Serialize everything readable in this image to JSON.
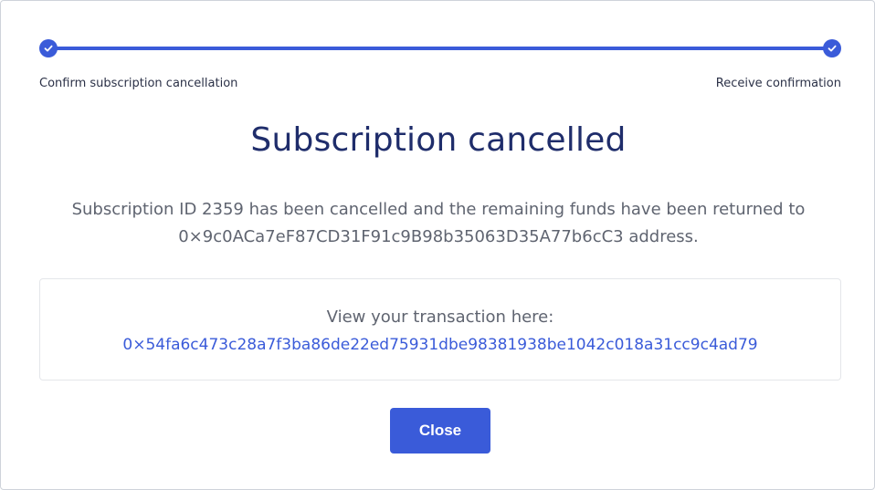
{
  "stepper": {
    "steps": [
      {
        "label": "Confirm subscription cancellation",
        "state": "complete"
      },
      {
        "label": "Receive confirmation",
        "state": "complete"
      }
    ],
    "accent_color": "#3a5bd9"
  },
  "title": "Subscription cancelled",
  "message": {
    "line1": "Subscription ID 2359 has been cancelled and the remaining funds have been returned to",
    "line2": "0×9c0ACa7eF87CD31F91c9B98b35063D35A77b6cC3 address."
  },
  "transaction": {
    "label": "View your transaction here:",
    "hash": "0×54fa6c473c28a7f3ba86de22ed75931dbe98381938be1042c018a31cc9c4ad79"
  },
  "actions": {
    "close_label": "Close"
  }
}
